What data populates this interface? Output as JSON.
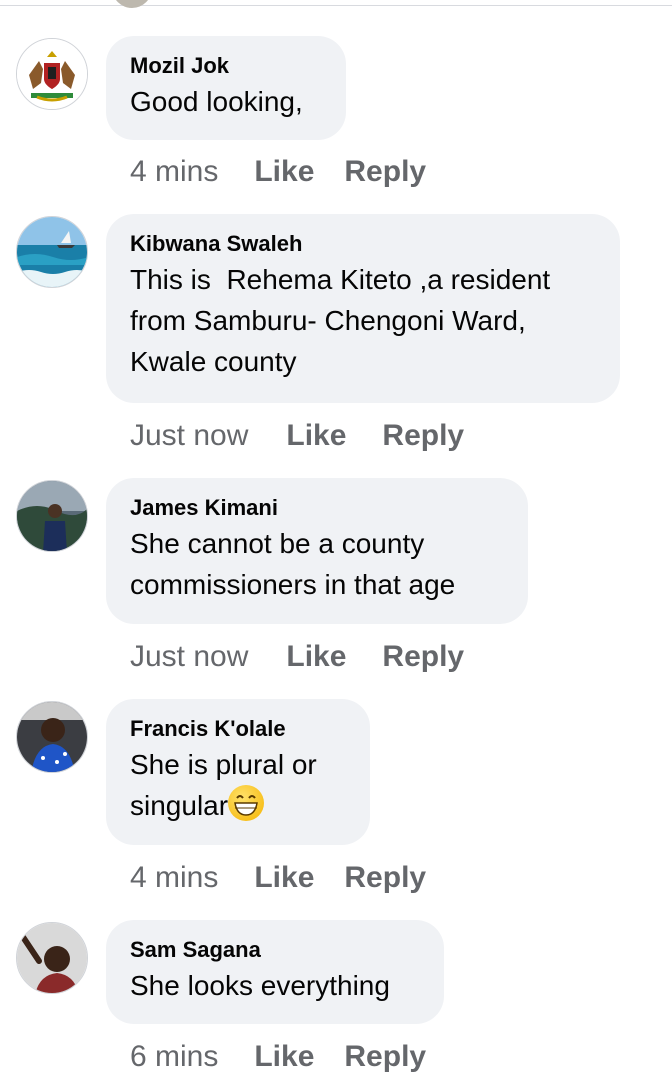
{
  "comments": [
    {
      "name": "Mozil Jok",
      "lines": [
        "Good looking,"
      ],
      "time": "4 mins",
      "avatar": "county-coat-of-arms-avatar"
    },
    {
      "name": "Kibwana Swaleh",
      "lines": [
        "This is  Rehema Kiteto ,a resident",
        "from Samburu- Chengoni Ward,",
        "Kwale county"
      ],
      "time": "Just now",
      "avatar": "ocean-dhow-avatar"
    },
    {
      "name": "James Kimani",
      "lines": [
        "She cannot be a county",
        "commissioners in that age"
      ],
      "time": "Just now",
      "avatar": "person-outdoors-avatar"
    },
    {
      "name": "Francis K'olale",
      "lines": [
        "She is plural or",
        "singular"
      ],
      "time": "4 mins",
      "emoji": "grinning-face-emoji",
      "avatar": "man-blue-shirt-avatar"
    },
    {
      "name": "Sam Sagana",
      "lines": [
        "She looks everything"
      ],
      "time": "6 mins",
      "avatar": "man-waving-avatar"
    }
  ],
  "actions": {
    "like": "Like",
    "reply": "Reply"
  },
  "colors": {
    "bubble": "#f0f2f5",
    "meta": "#65676b",
    "text": "#050505"
  }
}
